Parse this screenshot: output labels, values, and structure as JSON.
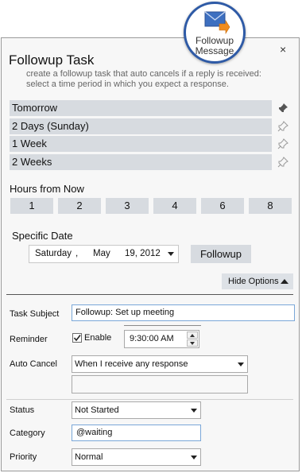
{
  "badge": {
    "line1": "Followup",
    "line2": "Message",
    "icon": "envelope-arrow-icon"
  },
  "panel": {
    "title": "Followup Task",
    "subtitle_line1": "create a followup task that auto cancels if a reply is received:",
    "subtitle_line2": "select a time period in which you expect a response.",
    "close_label": "×"
  },
  "quick_options": [
    {
      "label": "Tomorrow",
      "pinned": true
    },
    {
      "label": "2 Days (Sunday)",
      "pinned": false
    },
    {
      "label": "1 Week",
      "pinned": false
    },
    {
      "label": "2 Weeks",
      "pinned": false
    }
  ],
  "hours": {
    "label": "Hours from Now",
    "buttons": [
      "1",
      "2",
      "3",
      "4",
      "6",
      "8"
    ]
  },
  "specific_date": {
    "label": "Specific Date",
    "weekday": "Saturday",
    "sep": ",",
    "month": "May",
    "day_year": "19, 2012",
    "button": "Followup"
  },
  "hide_options": {
    "label": "Hide Options"
  },
  "form": {
    "task_subject": {
      "label": "Task Subject",
      "value": "Followup: Set up meeting"
    },
    "reminder": {
      "label": "Reminder",
      "enable_label": "Enable",
      "checked": true,
      "time": "9:30:00 AM"
    },
    "auto_cancel": {
      "label": "Auto Cancel",
      "selected": "When I receive any response",
      "extra": ""
    },
    "status": {
      "label": "Status",
      "selected": "Not Started"
    },
    "category": {
      "label": "Category",
      "value": "@waiting"
    },
    "priority": {
      "label": "Priority",
      "selected": "Normal"
    }
  },
  "colors": {
    "accent_border": "#2e5aa6",
    "button_bg": "#d7dbe0",
    "field_focus": "#7aa7d8"
  }
}
